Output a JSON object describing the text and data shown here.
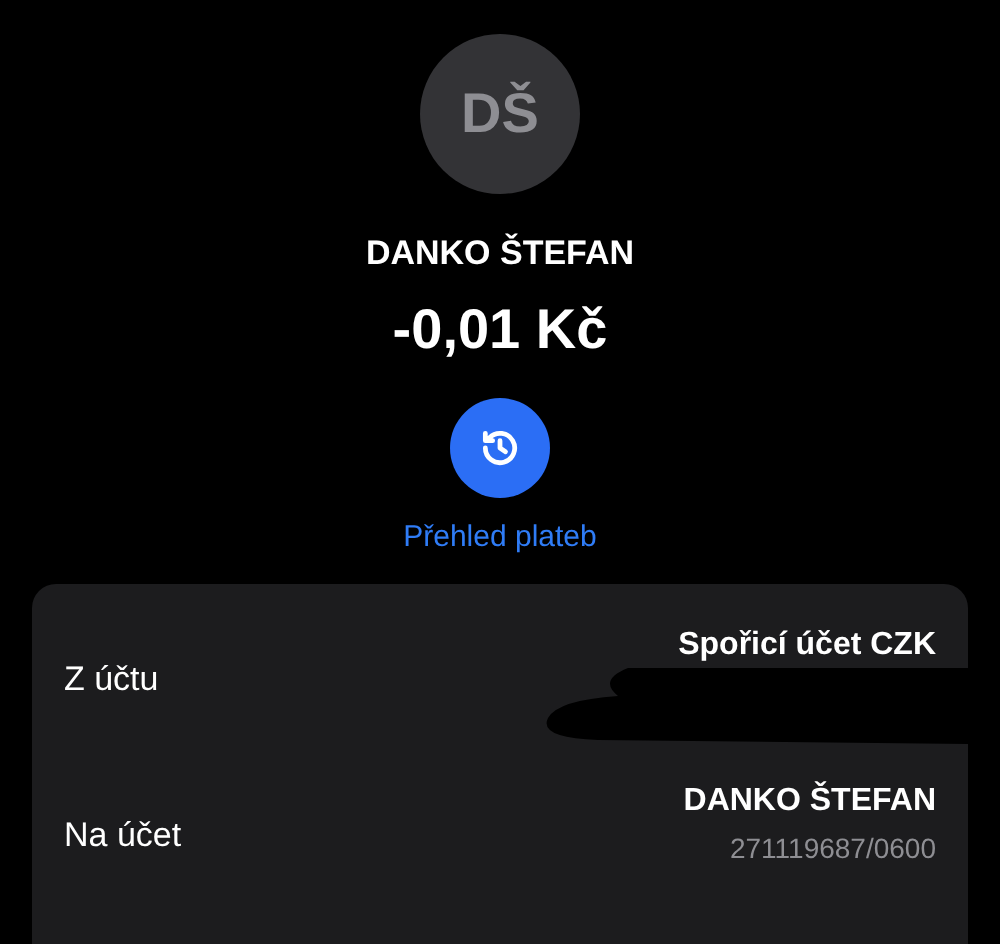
{
  "contact": {
    "initials": "DŠ",
    "name": "DANKO ŠTEFAN",
    "amount": "-0,01 Kč"
  },
  "history_link": {
    "label": "Přehled plateb"
  },
  "details": [
    {
      "label": "Z účtu",
      "value": "Spořicí účet CZK",
      "redacted": true
    },
    {
      "label": "Na účet",
      "value": "DANKO ŠTEFAN",
      "account": "271119687/0600",
      "redacted": false
    }
  ]
}
